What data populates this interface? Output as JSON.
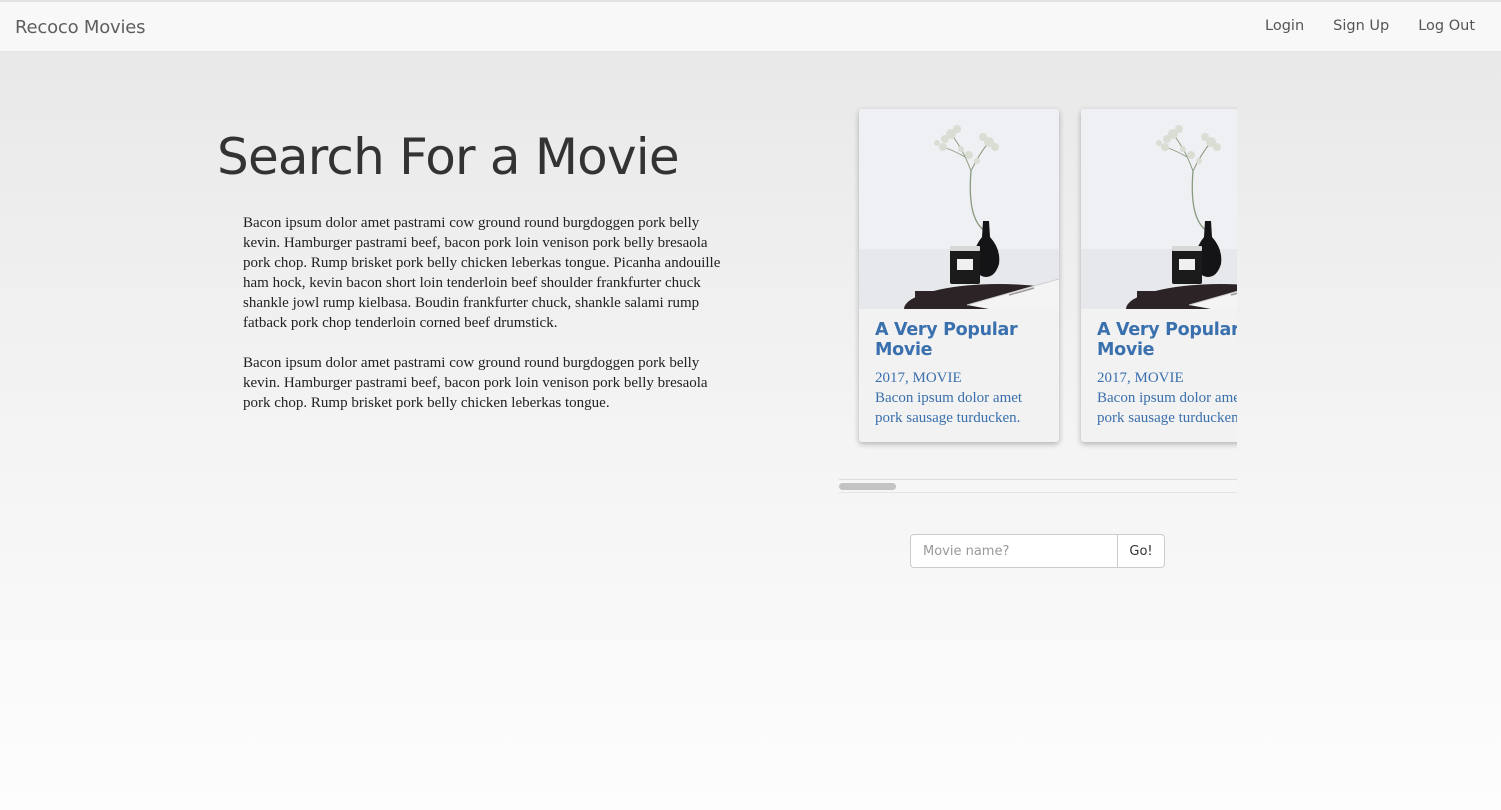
{
  "navbar": {
    "brand": "Recoco Movies",
    "links": [
      {
        "label": "Login"
      },
      {
        "label": "Sign Up"
      },
      {
        "label": "Log Out"
      }
    ]
  },
  "hero": {
    "title": "Search For a Movie",
    "paragraphs": [
      "Bacon ipsum dolor amet pastrami cow ground round burgdoggen pork belly kevin. Hamburger pastrami beef, bacon pork loin venison pork belly bresaola pork chop. Rump brisket pork belly chicken leberkas tongue. Picanha andouille ham hock, kevin bacon short loin tenderloin beef shoulder frankfurter chuck shankle jowl rump kielbasa. Boudin frankfurter chuck, shankle salami rump fatback pork chop tenderloin corned beef drumstick.",
      "Bacon ipsum dolor amet pastrami cow ground round burgdoggen pork belly kevin. Hamburger pastrami beef, bacon pork loin venison pork belly bresaola pork chop. Rump brisket pork belly chicken leberkas tongue."
    ]
  },
  "movies": [
    {
      "title_line1": "A Very Popular",
      "title_line2": "Movie",
      "meta": "2017, MOVIE",
      "desc_line1": "Bacon ipsum dolor amet",
      "desc_line2": "pork sausage turducken."
    },
    {
      "title_line1": "A Very Popular",
      "title_line2": "Movie",
      "meta": "2017, MOVIE",
      "desc_line1": "Bacon ipsum dolor amet",
      "desc_line2": "pork sausage turducken."
    }
  ],
  "carousel": {
    "scroll_position": 0
  },
  "search": {
    "placeholder": "Movie name?",
    "value": "",
    "button_label": "Go!"
  },
  "colors": {
    "accent": "#3a70ad",
    "navbar_bg": "#f8f8f8"
  }
}
